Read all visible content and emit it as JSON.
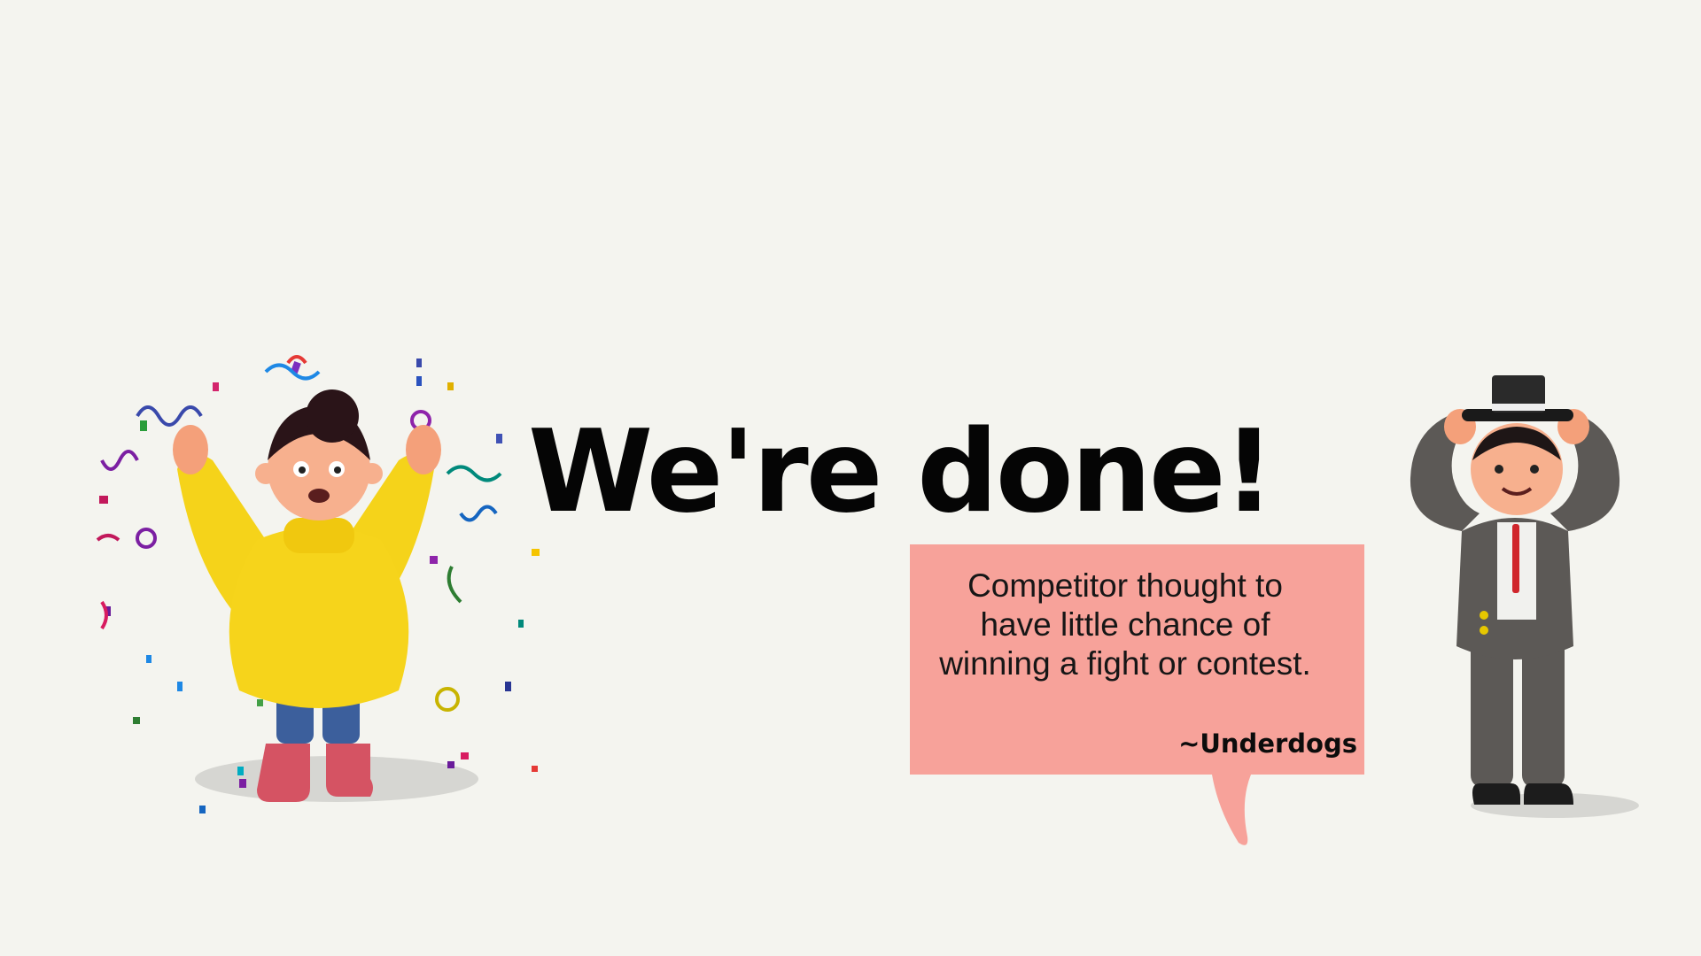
{
  "slide": {
    "headline": "We're done!",
    "quote": {
      "text": "Competitor thought to have little chance of winning a fight or contest.",
      "attribution": "~Underdogs"
    },
    "illustrations": {
      "left": "celebrating-girl-with-confetti",
      "right": "man-raising-top-hat"
    }
  },
  "colors": {
    "background": "#f4f4ef",
    "bubble": "#f7a29a",
    "text": "#050505"
  }
}
